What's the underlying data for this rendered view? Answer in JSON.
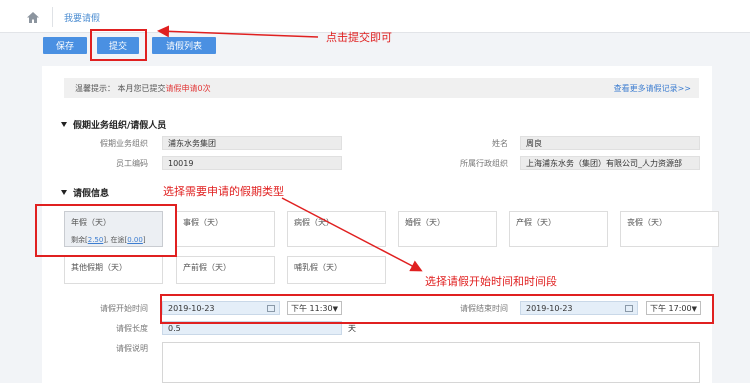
{
  "breadcrumb": {
    "home_icon": "home-icon",
    "current": "我要请假"
  },
  "toolbar": {
    "save_label": "保存",
    "submit_label": "提交",
    "list_label": "请假列表"
  },
  "tip": {
    "prefix": "温馨提示：",
    "text_before": "本月您已提交",
    "highlight": "请假申请0次",
    "link": "查看更多请假记录>>"
  },
  "section_person": {
    "title": "假期业务组织/请假人员",
    "org_label": "假期业务组织",
    "org_value": "浦东水务集团",
    "name_label": "姓名",
    "name_value": "周良",
    "emp_id_label": "员工编码",
    "emp_id_value": "10019",
    "dept_label": "所属行政组织",
    "dept_value": "上海浦东水务（集团）有限公司_人力资源部"
  },
  "section_leave": {
    "title": "请假信息",
    "types_row1": [
      {
        "label": "年假（天）",
        "balance_label": "剩余[",
        "balance": "2.50",
        "pending_label": "], 在途[",
        "pending": "0.00",
        "close": "]"
      },
      {
        "label": "事假（天）"
      },
      {
        "label": "病假（天）"
      },
      {
        "label": "婚假（天）"
      },
      {
        "label": "产假（天）"
      },
      {
        "label": "丧假（天）"
      }
    ],
    "types_row2": [
      {
        "label": "其他假期（天）"
      },
      {
        "label": "产前假（天）"
      },
      {
        "label": "哺乳假（天）"
      }
    ],
    "start_label": "请假开始时间",
    "start_date": "2019-10-23",
    "start_period": "下午 11:30",
    "end_label": "请假结束时间",
    "end_date": "2019-10-23",
    "end_period": "下午 17:00",
    "length_label": "请假长度",
    "length_value": "0.5",
    "length_unit": "天",
    "reason_label": "请假说明"
  },
  "annotations": {
    "submit_hint": "点击提交即可",
    "type_hint": "选择需要申请的假期类型",
    "time_hint": "选择请假开始时间和时间段"
  },
  "colors": {
    "primary": "#4a90e2",
    "annotation": "#e02020",
    "link": "#3d7dd0"
  }
}
